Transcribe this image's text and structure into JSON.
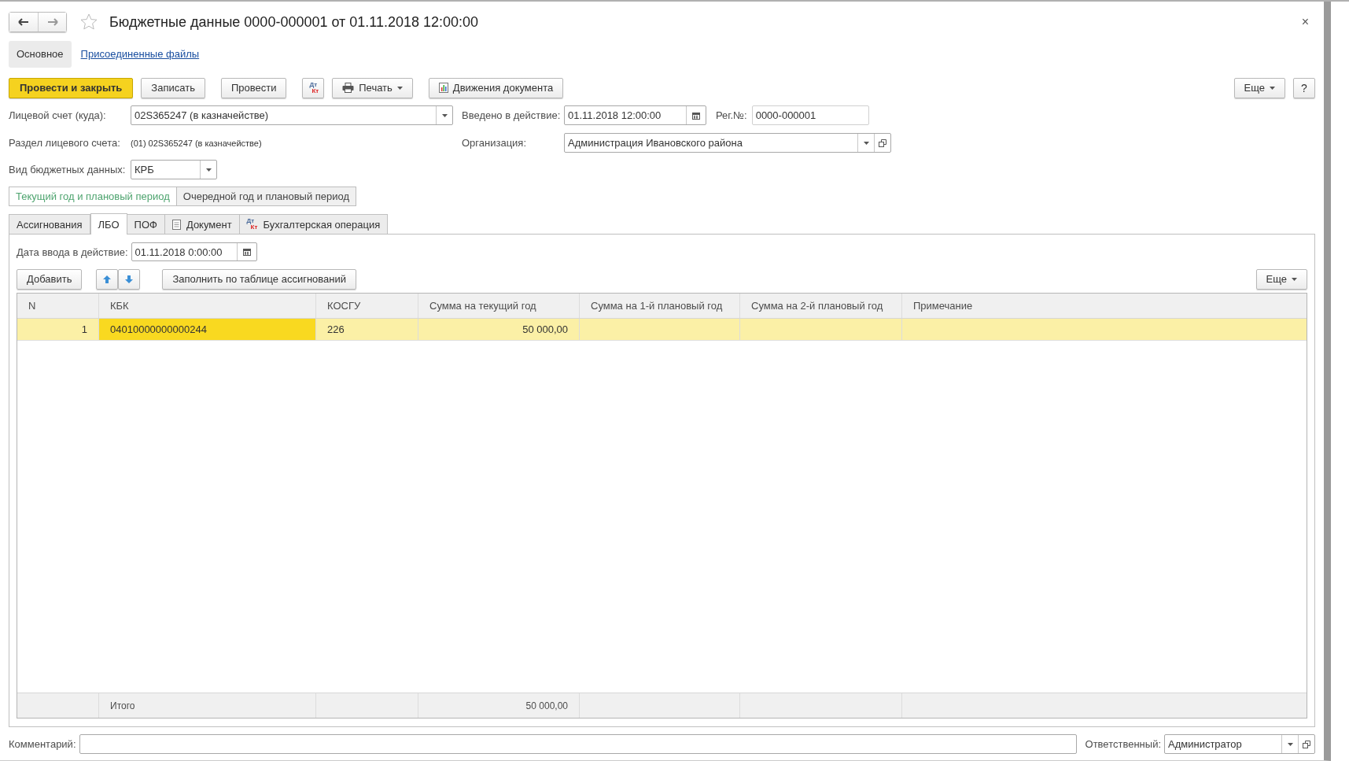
{
  "window": {
    "title": "Бюджетные данные 0000-000001 от 01.11.2018 12:00:00",
    "close": "×"
  },
  "form_tabs": [
    {
      "label": "Основное",
      "selected": true
    },
    {
      "label": "Присоединенные файлы",
      "selected": false
    }
  ],
  "toolbar": [
    {
      "label": "Провести и закрыть",
      "kind": "primary"
    },
    {
      "label": "Записать",
      "kind": "plain"
    },
    {
      "label": "Провести",
      "kind": "plain"
    },
    {
      "kind": "dtkt",
      "top": "Дт",
      "bottom": "Кт"
    },
    {
      "label": "Печать",
      "kind": "print"
    },
    {
      "label": "Движения документа",
      "kind": "report"
    }
  ],
  "more": "Еще",
  "help": "?",
  "account": {
    "label": "Лицевой счет (куда):",
    "value": "02S365247 (в казначействе)"
  },
  "enacted": {
    "label": "Введено в действие:",
    "value": "01.11.2018 12:00:00"
  },
  "reg_no": {
    "label": "Рег.№:",
    "value": "0000-000001"
  },
  "section": {
    "label": "Раздел лицевого счета:",
    "value": "(01) 02S365247 (в казначействе)"
  },
  "organization": {
    "label": "Организация:",
    "value": "Администрация Ивановского района"
  },
  "data_type": {
    "label": "Вид бюджетных данных:",
    "value": "КРБ"
  },
  "periods": [
    {
      "label": "Текущий год и плановый период",
      "selected": true
    },
    {
      "label": "Очередной год и плановый период",
      "selected": false
    }
  ],
  "tabs": [
    {
      "label": "Ассигнования",
      "selected": false,
      "kind": "text"
    },
    {
      "label": "ЛБО",
      "selected": true,
      "kind": "text"
    },
    {
      "label": "ПОФ",
      "selected": false,
      "kind": "text"
    },
    {
      "label": "Документ",
      "selected": false,
      "kind": "doc"
    },
    {
      "label": "Бухгалтерская операция",
      "selected": false,
      "kind": "dtkt",
      "top": "Дт",
      "bottom": "Кт"
    }
  ],
  "date_entry": {
    "label": "Дата ввода в действие:",
    "value": "01.11.2018  0:00:00"
  },
  "table_toolbar": {
    "add": "Добавить",
    "fill": "Заполнить по таблице ассигнований",
    "more": "Еще"
  },
  "table": {
    "columns": [
      "N",
      "КБК",
      "КОСГУ",
      "Сумма на текущий год",
      "Сумма на 1-й плановый год",
      "Сумма на 2-й плановый год",
      "Примечание"
    ],
    "rows": [
      {
        "selected": true,
        "cells": [
          {
            "text": "1",
            "current": false
          },
          {
            "text": "04010000000000244",
            "current": true
          },
          {
            "text": "226",
            "current": false
          },
          {
            "text": "50 000,00",
            "current": false
          }
        ]
      }
    ],
    "footer": {
      "label": "Итого",
      "total": "50 000,00"
    }
  },
  "comment": {
    "label": "Комментарий:"
  },
  "responsible": {
    "label": "Ответственный:",
    "value": "Администратор"
  }
}
